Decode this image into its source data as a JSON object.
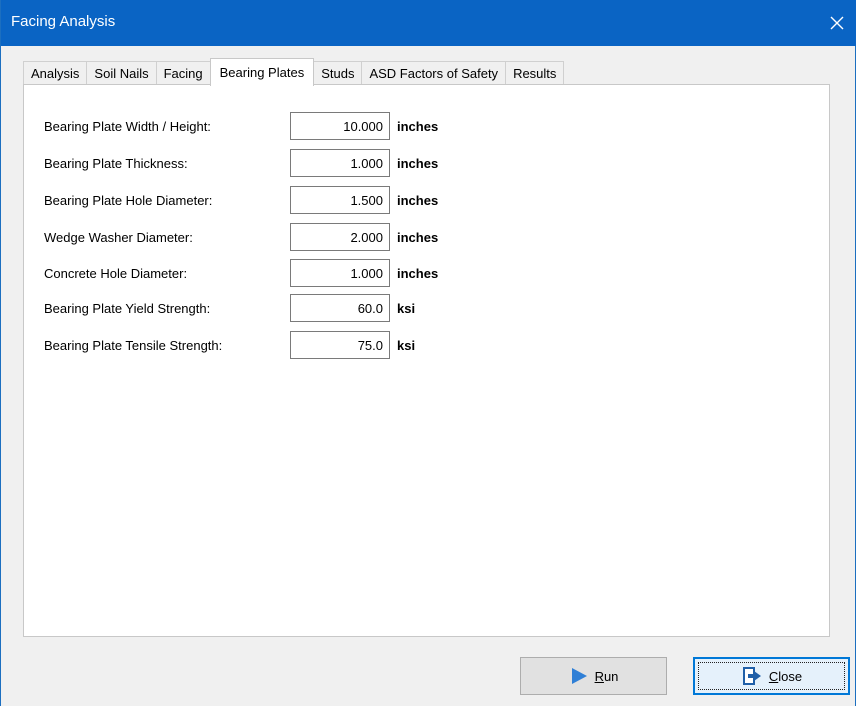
{
  "window": {
    "title": "Facing Analysis"
  },
  "tabs": [
    {
      "label": "Analysis",
      "active": false
    },
    {
      "label": "Soil Nails",
      "active": false
    },
    {
      "label": "Facing",
      "active": false
    },
    {
      "label": "Bearing Plates",
      "active": true
    },
    {
      "label": "Studs",
      "active": false
    },
    {
      "label": "ASD Factors of Safety",
      "active": false
    },
    {
      "label": "Results",
      "active": false
    }
  ],
  "fields": [
    {
      "label": "Bearing Plate Width / Height:",
      "value": "10.000",
      "unit": "inches"
    },
    {
      "label": "Bearing Plate Thickness:",
      "value": "1.000",
      "unit": "inches"
    },
    {
      "label": "Bearing Plate Hole Diameter:",
      "value": "1.500",
      "unit": "inches"
    },
    {
      "label": "Wedge Washer Diameter:",
      "value": "2.000",
      "unit": "inches"
    },
    {
      "label": "Concrete Hole Diameter:",
      "value": "1.000",
      "unit": "inches"
    },
    {
      "label": "Bearing Plate Yield Strength:",
      "value": "60.0",
      "unit": "ksi"
    },
    {
      "label": "Bearing Plate Tensile Strength:",
      "value": "75.0",
      "unit": "ksi"
    }
  ],
  "buttons": {
    "run": {
      "accel": "R",
      "rest": "un",
      "icon": "play-icon"
    },
    "close": {
      "accel": "C",
      "rest": "lose",
      "icon": "exit-door-icon"
    }
  },
  "colors": {
    "titlebar": "#0a64c4",
    "focus_border": "#0078d7",
    "run_icon": "#2f7fd6"
  }
}
